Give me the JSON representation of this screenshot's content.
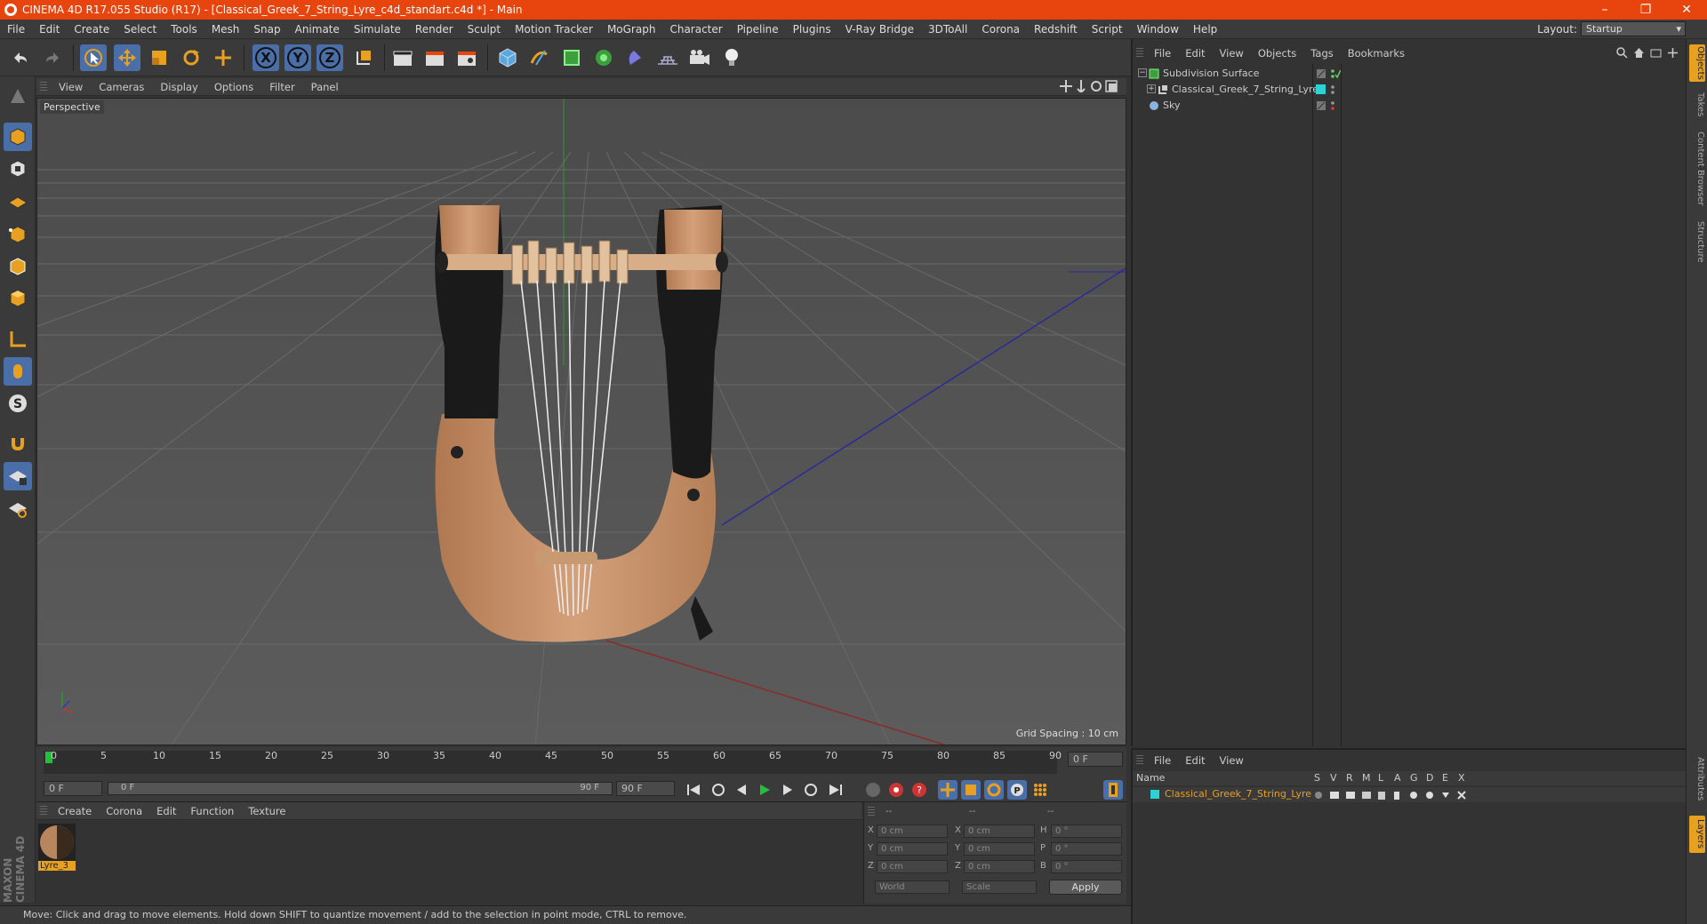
{
  "window": {
    "title": "CINEMA 4D R17.055 Studio (R17) - [Classical_Greek_7_String_Lyre_c4d_standart.c4d *] - Main"
  },
  "menus": [
    "File",
    "Edit",
    "Create",
    "Select",
    "Tools",
    "Mesh",
    "Snap",
    "Animate",
    "Simulate",
    "Render",
    "Sculpt",
    "Motion Tracker",
    "MoGraph",
    "Character",
    "Pipeline",
    "Plugins",
    "V-Ray Bridge",
    "3DToAll",
    "Corona",
    "Redshift",
    "Script",
    "Window",
    "Help"
  ],
  "layout": {
    "label": "Layout:",
    "value": "Startup"
  },
  "viewport": {
    "menu": [
      "View",
      "Cameras",
      "Display",
      "Options",
      "Filter",
      "Panel"
    ],
    "label": "Perspective",
    "grid_spacing": "Grid Spacing : 10 cm"
  },
  "toolbar": {
    "axis_x": "X",
    "axis_y": "Y",
    "axis_z": "Z"
  },
  "timeline": {
    "ticks": [
      "0",
      "5",
      "10",
      "15",
      "20",
      "25",
      "30",
      "35",
      "40",
      "45",
      "50",
      "55",
      "60",
      "65",
      "70",
      "75",
      "80",
      "85",
      "90"
    ],
    "current_frame": "0 F",
    "start_frame": "0 F",
    "range_start": "0 F",
    "range_end": "90 F",
    "end_frame": "90 F"
  },
  "materials": {
    "menu": [
      "Create",
      "Corona",
      "Edit",
      "Function",
      "Texture"
    ],
    "items": [
      {
        "name": "Lyre_3"
      }
    ]
  },
  "coordinates": {
    "headers": [
      "--",
      "--",
      "--"
    ],
    "rows": [
      {
        "a": "X",
        "av": "0 cm",
        "b": "X",
        "bv": "0 cm",
        "c": "H",
        "cv": "0 °"
      },
      {
        "a": "Y",
        "av": "0 cm",
        "b": "Y",
        "bv": "0 cm",
        "c": "P",
        "cv": "0 °"
      },
      {
        "a": "Z",
        "av": "0 cm",
        "b": "Z",
        "bv": "0 cm",
        "c": "B",
        "cv": "0 °"
      }
    ],
    "world": "World",
    "scale": "Scale",
    "apply": "Apply"
  },
  "objects": {
    "menu": [
      "File",
      "Edit",
      "View",
      "Objects",
      "Tags",
      "Bookmarks"
    ],
    "items": [
      {
        "name": "Subdivision Surface"
      },
      {
        "name": "Classical_Greek_7_String_Lyre"
      },
      {
        "name": "Sky"
      }
    ]
  },
  "layers": {
    "menu": [
      "File",
      "Edit",
      "View"
    ],
    "header_name": "Name",
    "columns": [
      "S",
      "V",
      "R",
      "M",
      "L",
      "A",
      "G",
      "D",
      "E",
      "X"
    ],
    "items": [
      {
        "name": "Classical_Greek_7_String_Lyre"
      }
    ]
  },
  "right_tabs": [
    "Objects",
    "Takes",
    "Content Browser",
    "Structure",
    "Attributes",
    "Layers"
  ],
  "logo": {
    "text": "MAXON CINEMA 4D"
  },
  "status": "Move: Click and drag to move elements. Hold down SHIFT to quantize movement / add to the selection in point mode, CTRL to remove.",
  "colors": {
    "title_bar": "#e8450e",
    "accent": "#4a6fa8",
    "layer_text": "#e8a020"
  }
}
